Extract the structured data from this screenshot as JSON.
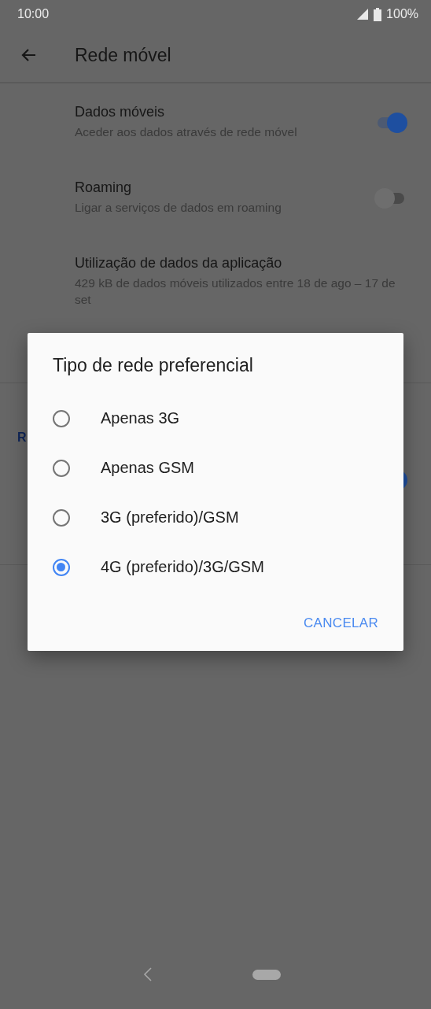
{
  "status_bar": {
    "time": "10:00",
    "battery": "100%"
  },
  "app_bar": {
    "title": "Rede móvel"
  },
  "settings": [
    {
      "title": "Dados móveis",
      "subtitle": "Aceder aos dados através de rede móvel",
      "kind": "toggle",
      "on": true
    },
    {
      "title": "Roaming",
      "subtitle": "Ligar a serviços de dados em roaming",
      "kind": "toggle",
      "on": false
    },
    {
      "title": "Utilização de dados da aplicação",
      "subtitle": "429 kB de dados móveis utilizados entre 18 de ago – 17 de set",
      "kind": "text"
    }
  ],
  "section": {
    "header": "R",
    "toggle_on": true
  },
  "dialog": {
    "title": "Tipo de rede preferencial",
    "options": [
      {
        "label": "Apenas 3G",
        "selected": false
      },
      {
        "label": "Apenas GSM",
        "selected": false
      },
      {
        "label": "3G (preferido)/GSM",
        "selected": false
      },
      {
        "label": "4G (preferido)/3G/GSM",
        "selected": true
      }
    ],
    "button": "CANCELAR"
  }
}
